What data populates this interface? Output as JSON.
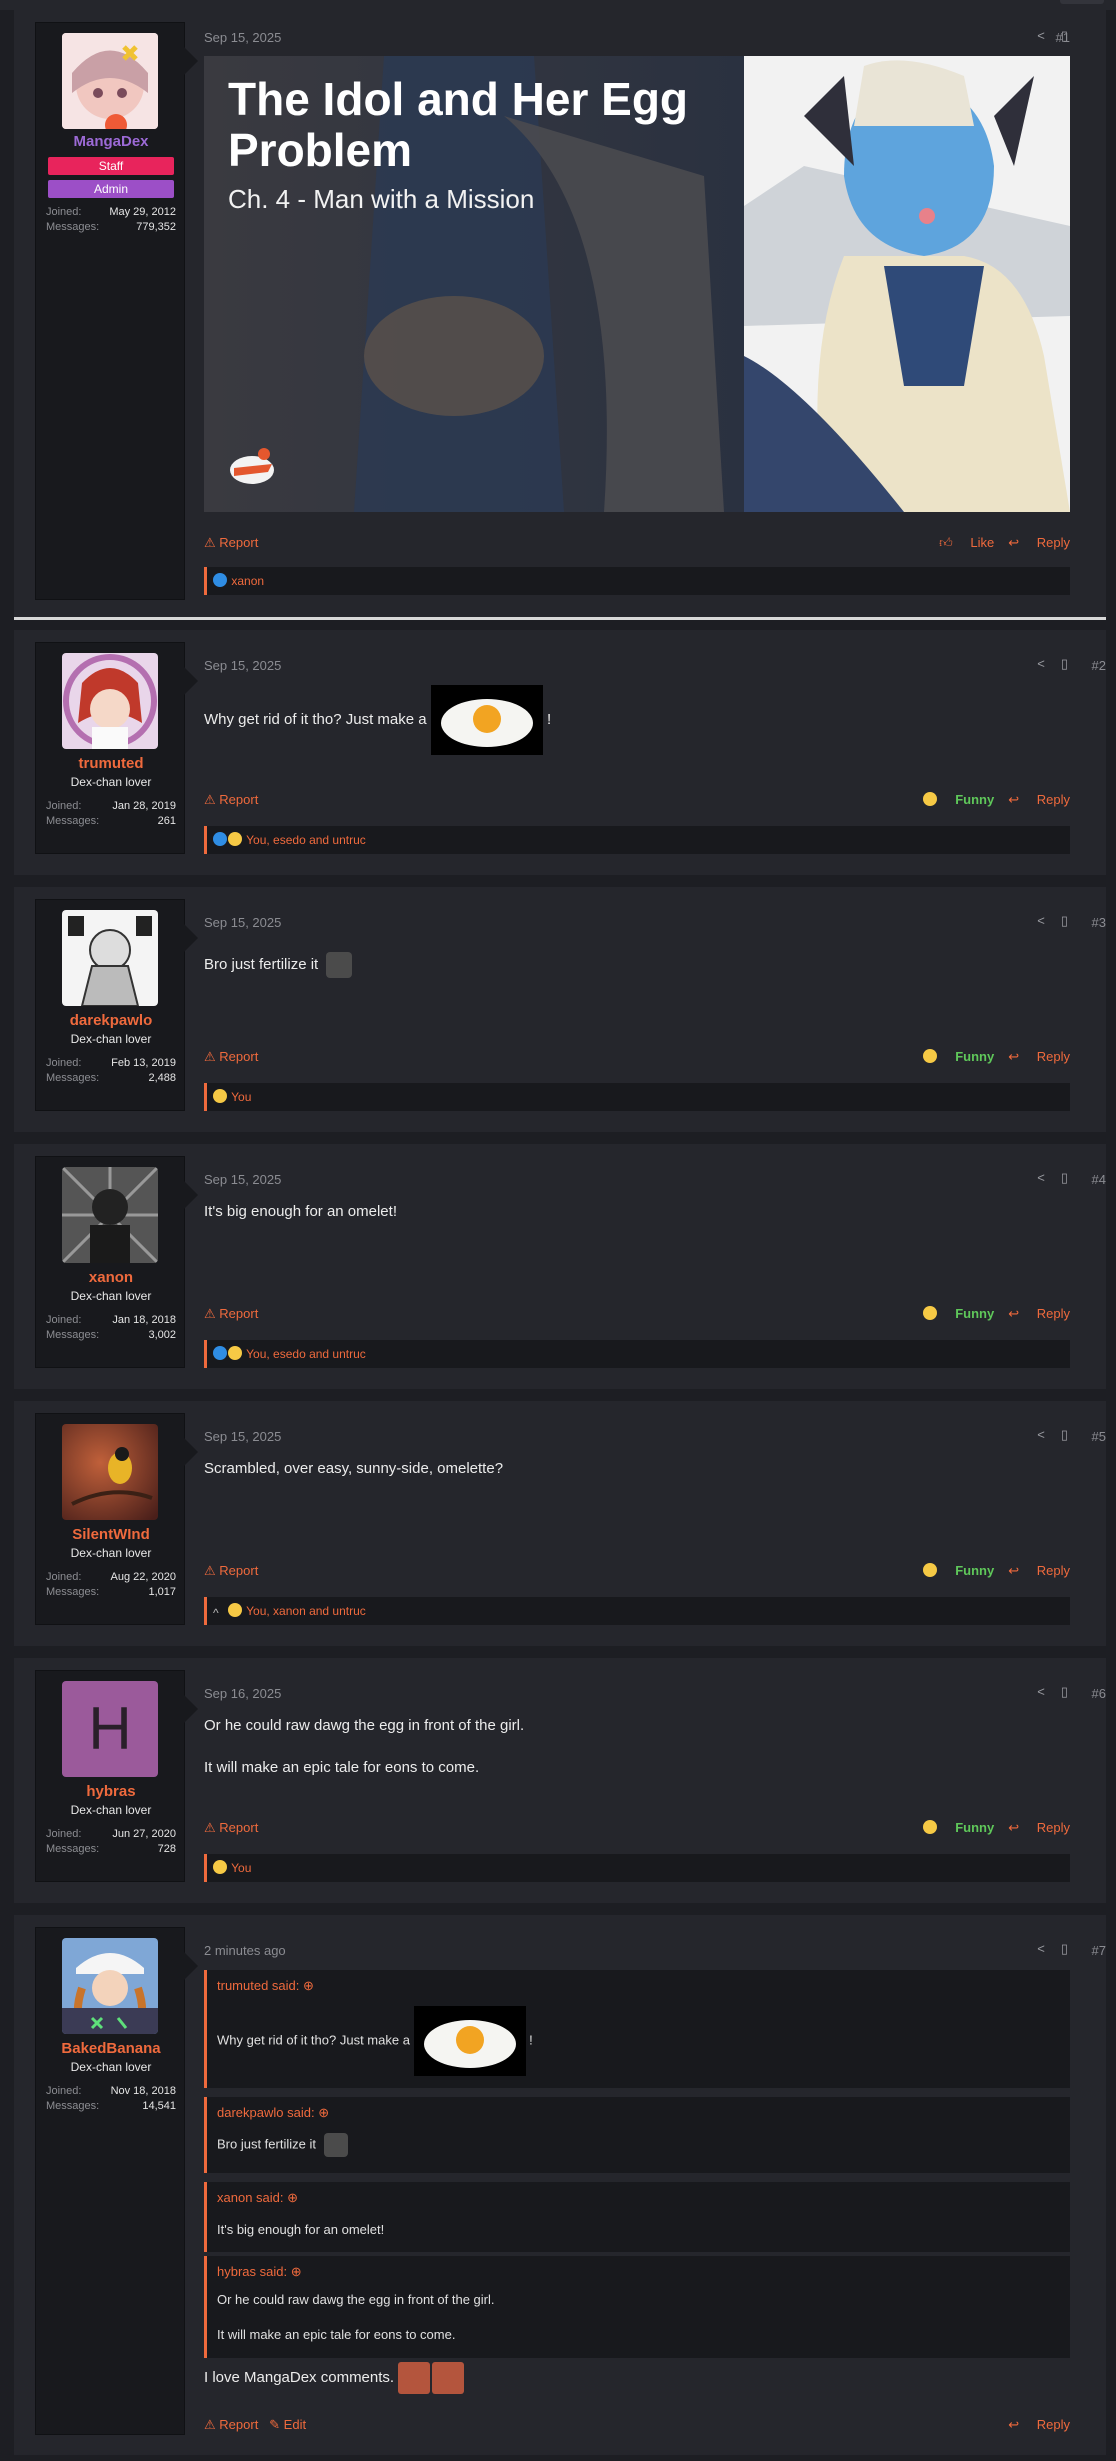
{
  "posts": [
    {
      "user": {
        "name": "MangaDex",
        "badges": [
          "Staff",
          "Admin"
        ],
        "joined": "May 29, 2012",
        "messages": "779,352"
      },
      "date": "Sep 15, 2025",
      "num": "#1",
      "banner": {
        "title": "The Idol and Her Egg Problem",
        "subtitle": "Ch. 4 - Man with a Mission"
      },
      "actions": {
        "report": "Report",
        "like": "Like",
        "reply": "Reply"
      },
      "reactions": "xanon"
    },
    {
      "user": {
        "name": "trumuted",
        "title": "Dex-chan lover",
        "joined": "Jan 28, 2019",
        "messages": "261"
      },
      "date": "Sep 15, 2025",
      "num": "#2",
      "text_before": "Why get rid of it tho? Just make a",
      "text_after": "!",
      "actions": {
        "report": "Report",
        "funny": "Funny",
        "reply": "Reply"
      },
      "reactions": "You, esedo and untruc"
    },
    {
      "user": {
        "name": "darekpawlo",
        "title": "Dex-chan lover",
        "joined": "Feb 13, 2019",
        "messages": "2,488"
      },
      "date": "Sep 15, 2025",
      "num": "#3",
      "text": "Bro just fertilize it",
      "actions": {
        "report": "Report",
        "funny": "Funny",
        "reply": "Reply"
      },
      "reactions": "You"
    },
    {
      "user": {
        "name": "xanon",
        "title": "Dex-chan lover",
        "joined": "Jan 18, 2018",
        "messages": "3,002"
      },
      "date": "Sep 15, 2025",
      "num": "#4",
      "text": "It's big enough for an omelet!",
      "actions": {
        "report": "Report",
        "funny": "Funny",
        "reply": "Reply"
      },
      "reactions": "You, esedo and untruc"
    },
    {
      "user": {
        "name": "SilentWInd",
        "title": "Dex-chan lover",
        "joined": "Aug 22, 2020",
        "messages": "1,017"
      },
      "date": "Sep 15, 2025",
      "num": "#5",
      "text": "Scrambled, over easy, sunny-side, omelette?",
      "actions": {
        "report": "Report",
        "funny": "Funny",
        "reply": "Reply"
      },
      "reactions": "You, xanon and untruc"
    },
    {
      "user": {
        "name": "hybras",
        "title": "Dex-chan lover",
        "joined": "Jun 27, 2020",
        "messages": "728",
        "avatar_letter": "H"
      },
      "date": "Sep 16, 2025",
      "num": "#6",
      "text1": "Or he could raw dawg the egg in front of the girl.",
      "text2": "It will make an epic tale for eons to come.",
      "actions": {
        "report": "Report",
        "funny": "Funny",
        "reply": "Reply"
      },
      "reactions": "You"
    },
    {
      "user": {
        "name": "BakedBanana",
        "title": "Dex-chan lover",
        "joined": "Nov 18, 2018",
        "messages": "14,541"
      },
      "date": "2 minutes ago",
      "num": "#7",
      "quotes": [
        {
          "author": "trumuted said:",
          "text_before": "Why get rid of it tho? Just make a",
          "text_after": "!"
        },
        {
          "author": "darekpawlo said:",
          "text": "Bro just fertilize it"
        },
        {
          "author": "xanon said:",
          "text": "It's big enough for an omelet!"
        },
        {
          "author": "hybras said:",
          "text1": "Or he could raw dawg the egg in front of the girl.",
          "text2": "It will make an epic tale for eons to come."
        }
      ],
      "text": "I love MangaDex comments.",
      "actions": {
        "report": "Report",
        "edit": "Edit",
        "reply": "Reply"
      }
    }
  ],
  "labels": {
    "joined": "Joined:",
    "messages": "Messages:"
  },
  "icons": {
    "share": "share-icon",
    "bookmark": "bookmark-icon",
    "report": "warning-icon",
    "reply": "reply-icon",
    "like": "thumbs-up-icon",
    "funny": "laugh-icon",
    "edit": "edit-icon",
    "quote_link": "arrow-up-circle-icon"
  },
  "colors": {
    "accent": "#ef6a3d",
    "staff": "#e8245c",
    "admin": "#9c4fc7",
    "funny": "#5fc75a",
    "admin_name": "#9c6ad6"
  }
}
